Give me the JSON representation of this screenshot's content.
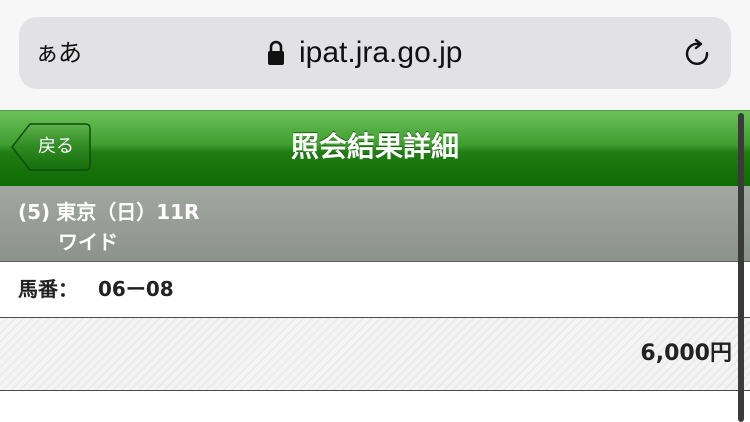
{
  "browser": {
    "text_size_button": "ぁあ",
    "url": "ipat.jra.go.jp",
    "lock_icon": "lock-icon",
    "reload_icon": "reload-icon"
  },
  "header": {
    "back_label": "戻る",
    "title": "照会結果詳細",
    "accent_color": "#1f7d12"
  },
  "race": {
    "number": "(5)",
    "venue_day": "東京（日）11R",
    "bet_type": "ワイド"
  },
  "bet": {
    "horse_label": "馬番：",
    "horse_numbers": "06ー08",
    "amount": "6,000円"
  }
}
